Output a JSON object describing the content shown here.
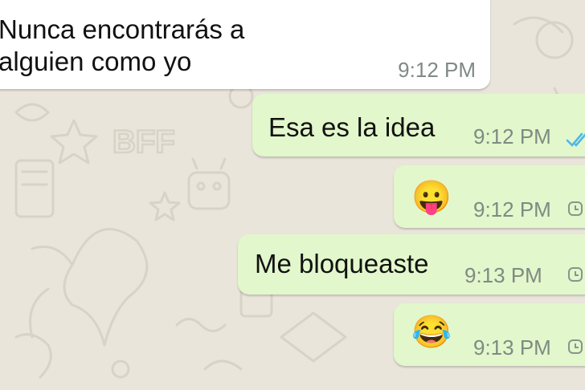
{
  "chat": {
    "messages": [
      {
        "direction": "incoming",
        "text_line1": "Nunca encontrarás a",
        "text_line2": "alguien como yo",
        "time": "9:12 PM"
      },
      {
        "direction": "outgoing",
        "text": "Esa es la idea",
        "time": "9:12 PM",
        "status_icon": "double-check-icon"
      },
      {
        "direction": "outgoing",
        "emoji": "😛",
        "emoji_icon": "tongue-out-emoji",
        "time": "9:12 PM",
        "status_icon": "clock-icon"
      },
      {
        "direction": "outgoing",
        "text": "Me bloqueaste",
        "time": "9:13 PM",
        "status_icon": "clock-icon"
      },
      {
        "direction": "outgoing",
        "emoji": "😂",
        "emoji_icon": "tears-of-joy-emoji",
        "time": "9:13 PM",
        "status_icon": "clock-icon"
      }
    ]
  },
  "wallpaper": {
    "doodle_text": "BFF"
  },
  "colors": {
    "wallpaper": "#e9e5da",
    "incoming_bubble": "#ffffff",
    "outgoing_bubble": "#e2f7cb",
    "read_ticks": "#4fb6ec",
    "time_text": "#7f8a84"
  }
}
